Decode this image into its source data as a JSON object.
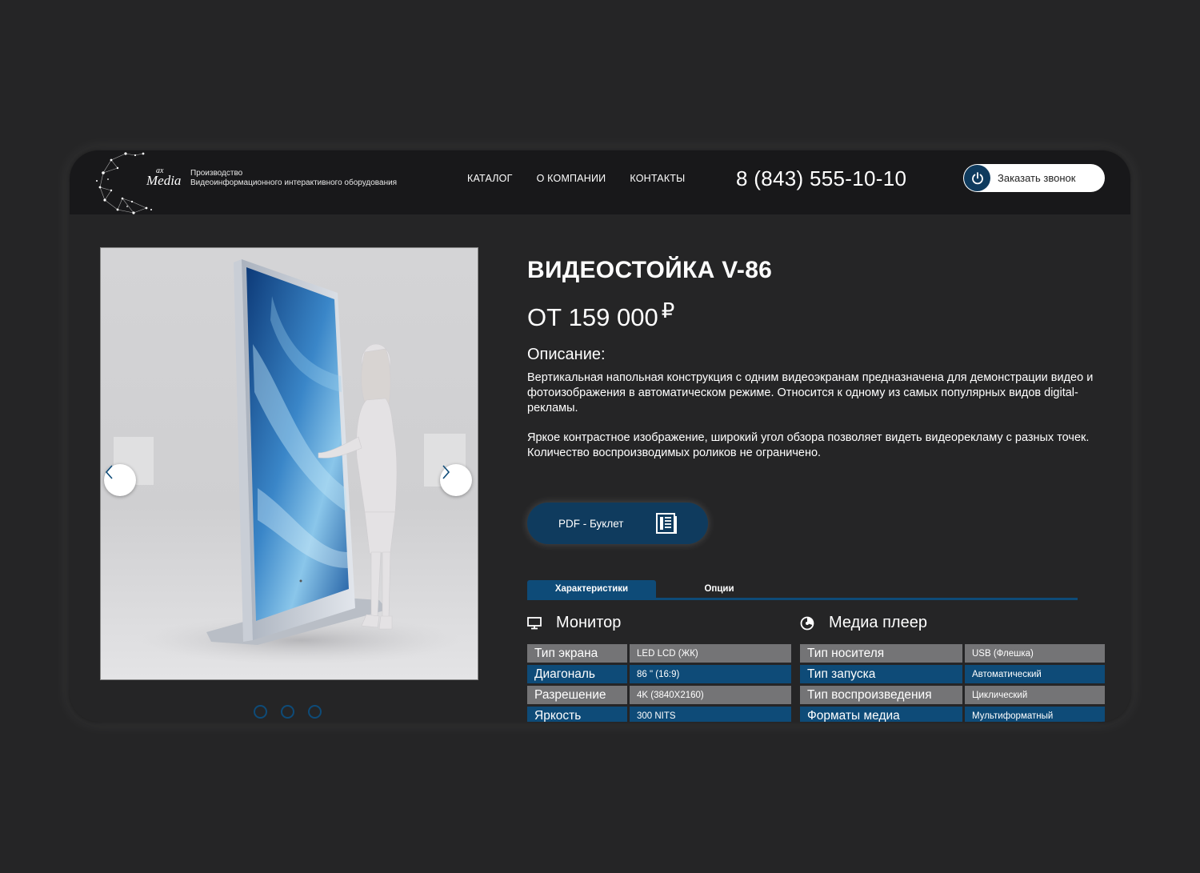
{
  "header": {
    "logo_text": "Media",
    "logo_ax": "ax",
    "tagline_line1": "Производство",
    "tagline_line2": "Видеоинформационного интерактивного оборудования",
    "nav": [
      "КАТАЛОГ",
      "О КОМПАНИИ",
      "КОНТАКТЫ"
    ],
    "phone": "8 (843) 555-10-10",
    "callback_label": "Заказать звонок"
  },
  "product": {
    "title": "ВИДЕОСТОЙКА V-86",
    "price": "ОТ 159 000",
    "currency": "₽",
    "description_heading": "Описание:",
    "description_p1": "Вертикальная напольная конструкция с одним видеоэкранам предназначена для демонстрации видео и фотоизображения в автоматическом режиме. Относится к одному из самых популярных видов digital-рекламы.",
    "description_p2": "Яркое контрастное изображение, широкий угол обзора позволяет видеть видеорекламу с разных точек. Количество воспроизводимых роликов не ограничено.",
    "pdf_label": "PDF - Буклет"
  },
  "tabs": {
    "specs": "Характеристики",
    "options": "Опции"
  },
  "monitor": {
    "heading": "Монитор",
    "rows": [
      {
        "key": "Тип экрана",
        "value": "LED LCD (ЖК)"
      },
      {
        "key": "Диагональ",
        "value": "86 \" (16:9)"
      },
      {
        "key": "Разрешение",
        "value": "4K (3840X2160)"
      },
      {
        "key": "Яркость",
        "value": "300 NITS"
      }
    ]
  },
  "player": {
    "heading": "Медиа плеер",
    "rows": [
      {
        "key": "Тип носителя",
        "value": "USB (Флешка)"
      },
      {
        "key": "Тип запуска",
        "value": "Автоматический"
      },
      {
        "key": "Тип воспроизведения",
        "value": "Циклический"
      },
      {
        "key": "Форматы медиа",
        "value": "Мультиформатный"
      }
    ]
  },
  "slider": {
    "dots": 3
  },
  "colors": {
    "accent": "#0e4b78",
    "button": "#0f3b5e",
    "row_gray": "#747476",
    "background": "#252526",
    "header": "#18181a"
  }
}
